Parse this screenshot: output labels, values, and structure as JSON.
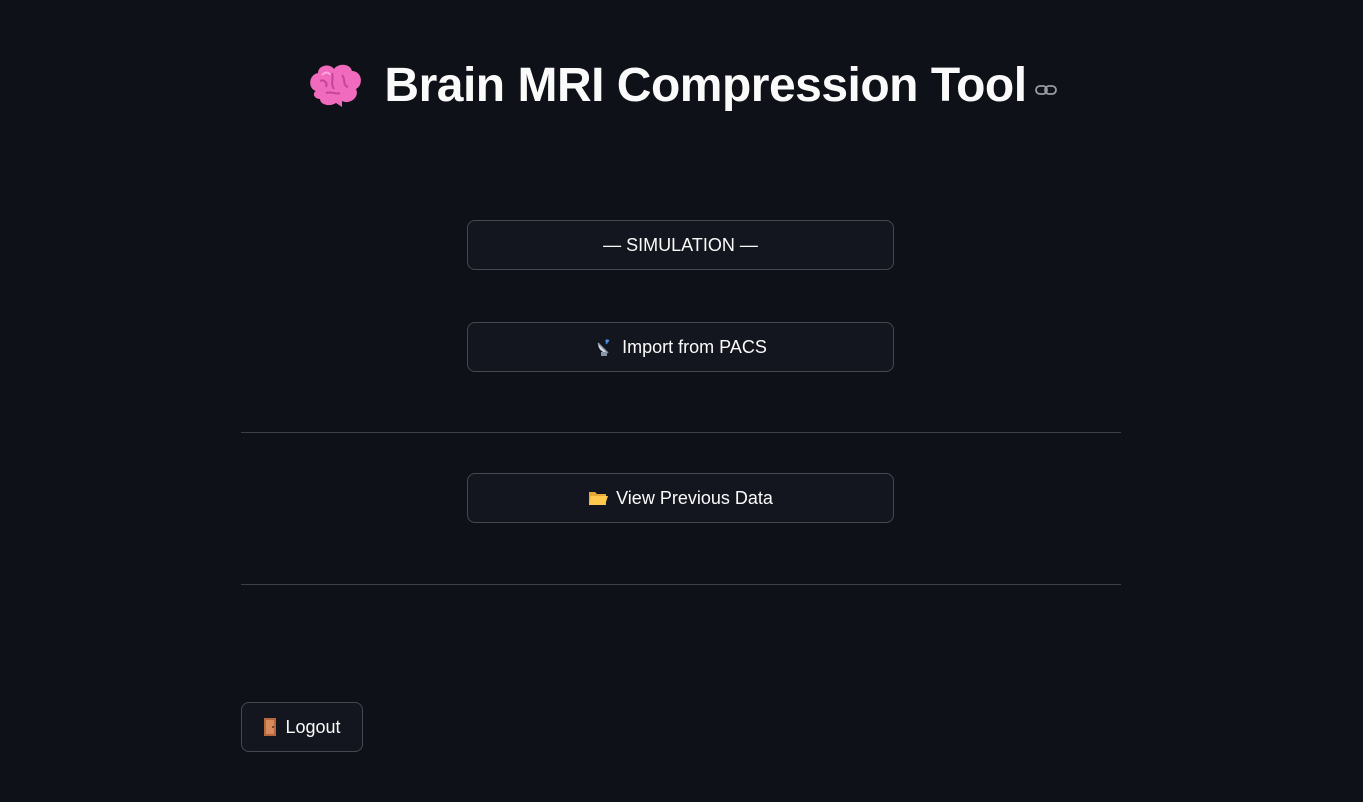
{
  "header": {
    "title": "Brain MRI Compression Tool",
    "title_icon": "brain-icon",
    "anchor_icon": "link-icon"
  },
  "buttons": {
    "simulation_label": "— SIMULATION —",
    "import_label": "Import from PACS",
    "import_icon": "satellite-dish-icon",
    "view_label": "View Previous Data",
    "view_icon": "folder-icon",
    "logout_label": "Logout",
    "logout_icon": "door-icon"
  },
  "colors": {
    "background": "#0e1117",
    "text": "#fafafa",
    "button_bg": "#13161e",
    "brain_pink": "#f472c0"
  }
}
